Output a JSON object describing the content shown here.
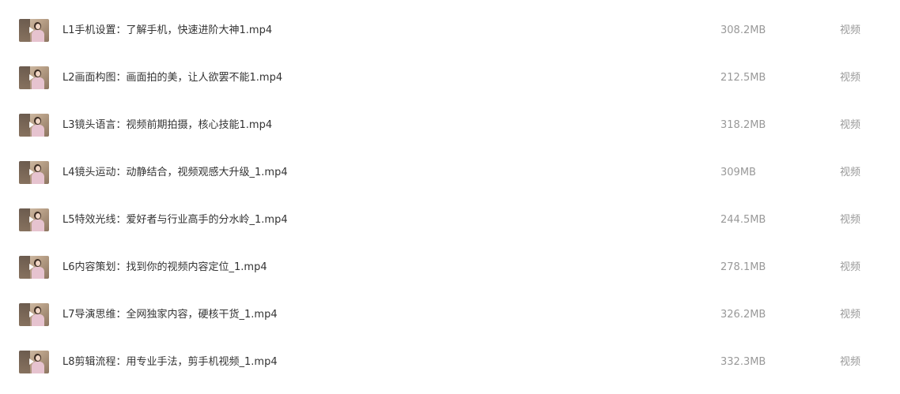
{
  "files": [
    {
      "name": "L1手机设置：了解手机，快速进阶大神1.mp4",
      "size": "308.2MB",
      "type": "视频",
      "thumb_icon": "video-thumbnail-icon"
    },
    {
      "name": "L2画面构图：画面拍的美，让人欲罢不能1.mp4",
      "size": "212.5MB",
      "type": "视频",
      "thumb_icon": "video-thumbnail-icon"
    },
    {
      "name": "L3镜头语言：视频前期拍摄，核心技能1.mp4",
      "size": "318.2MB",
      "type": "视频",
      "thumb_icon": "video-thumbnail-icon"
    },
    {
      "name": "L4镜头运动：动静结合，视频观感大升级_1.mp4",
      "size": "309MB",
      "type": "视频",
      "thumb_icon": "video-thumbnail-icon"
    },
    {
      "name": "L5特效光线：爱好者与行业高手的分水岭_1.mp4",
      "size": "244.5MB",
      "type": "视频",
      "thumb_icon": "video-thumbnail-icon"
    },
    {
      "name": "L6内容策划：找到你的视频内容定位_1.mp4",
      "size": "278.1MB",
      "type": "视频",
      "thumb_icon": "video-thumbnail-icon"
    },
    {
      "name": "L7导演思维：全网独家内容，硬核干货_1.mp4",
      "size": "326.2MB",
      "type": "视频",
      "thumb_icon": "video-thumbnail-icon"
    },
    {
      "name": "L8剪辑流程：用专业手法，剪手机视频_1.mp4",
      "size": "332.3MB",
      "type": "视频",
      "thumb_icon": "video-thumbnail-icon"
    }
  ]
}
